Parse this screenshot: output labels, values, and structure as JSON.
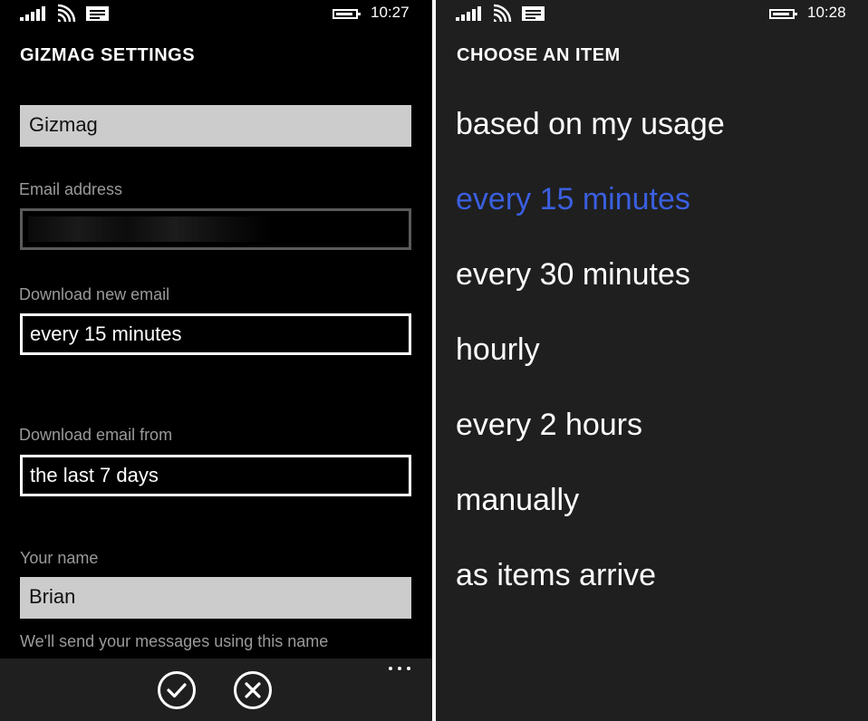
{
  "left": {
    "status_time": "10:27",
    "title": "GIZMAG SETTINGS",
    "account_name": "Gizmag",
    "email_label": "Email address",
    "download_new_label": "Download new email",
    "download_new_value": "every 15 minutes",
    "download_from_label": "Download email from",
    "download_from_value": "the last 7 days",
    "your_name_label": "Your name",
    "your_name_value": "Brian",
    "your_name_hint": "We'll send your messages using this name",
    "appbar": {
      "accept_icon": "checkmark-icon",
      "cancel_icon": "close-icon",
      "more_icon": "ellipsis-icon"
    }
  },
  "right": {
    "status_time": "10:28",
    "title": "CHOOSE AN ITEM",
    "options": [
      "based on my usage",
      "every 15 minutes",
      "every 30 minutes",
      "hourly",
      "every 2 hours",
      "manually",
      "as items arrive"
    ],
    "selected_index": 1
  },
  "colors": {
    "accent": "#3a5fe0",
    "left_bg": "#000000",
    "right_bg": "#1f1f1f"
  }
}
